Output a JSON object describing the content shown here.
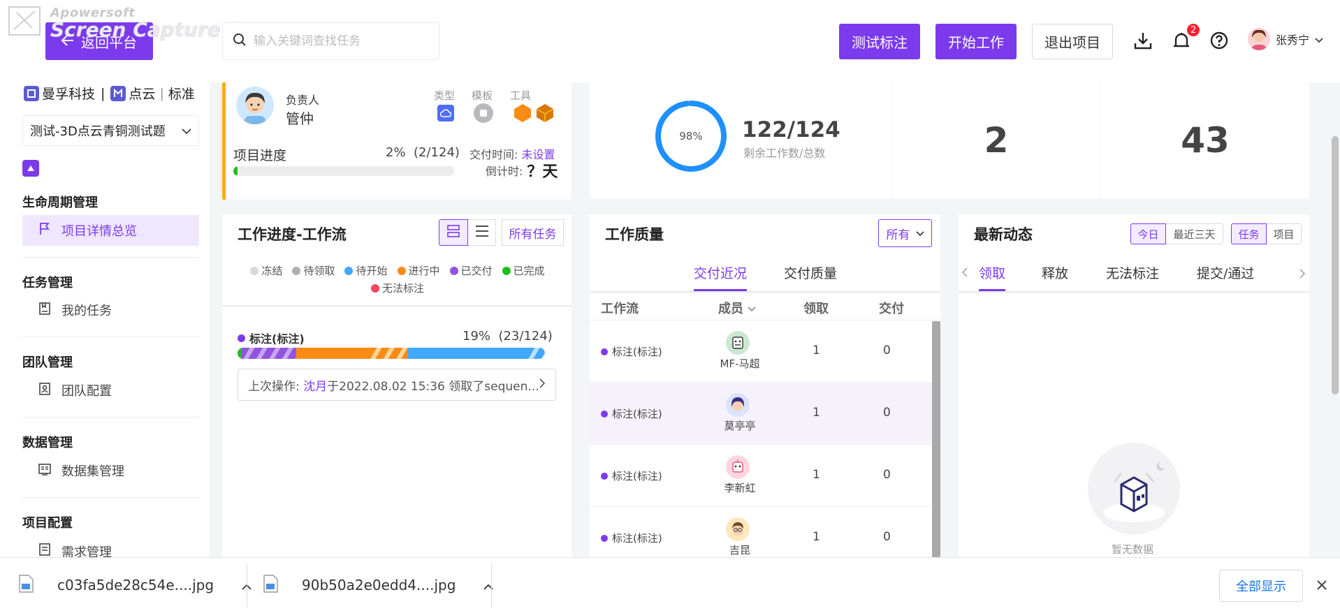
{
  "watermark": {
    "sub": "Apowersoft",
    "main": "Screen Capture Pro"
  },
  "header": {
    "back_label": "返回平台",
    "search_placeholder": "输入关键词查找任务",
    "btn_test": "测试标注",
    "btn_start": "开始工作",
    "btn_exit": "退出项目",
    "notification_count": "2",
    "user_name": "张秀宁"
  },
  "sidebar": {
    "org_name": "曼孚科技",
    "org_sep": "|",
    "org_type": "点云",
    "org_level": "标准",
    "project_name": "测试-3D点云青铜测试题",
    "sections": [
      {
        "title": "生命周期管理",
        "items": [
          {
            "label": "项目详情总览",
            "icon": "flag-icon"
          }
        ]
      },
      {
        "title": "任务管理",
        "items": [
          {
            "label": "我的任务",
            "icon": "task-icon"
          }
        ]
      },
      {
        "title": "团队管理",
        "items": [
          {
            "label": "团队配置",
            "icon": "team-icon"
          }
        ]
      },
      {
        "title": "数据管理",
        "items": [
          {
            "label": "数据集管理",
            "icon": "dataset-icon"
          }
        ]
      },
      {
        "title": "项目配置",
        "items": [
          {
            "label": "需求管理",
            "icon": "requirement-icon"
          }
        ]
      }
    ]
  },
  "project_card": {
    "owner_label": "负责人",
    "owner_name": "管仲",
    "type_label": "类型",
    "template_label": "模板",
    "tool_label": "工具",
    "progress_label": "项目进度",
    "progress_text": "2%  (2/124)",
    "progress_value": 0.02,
    "delivery_label": "交付时间:",
    "delivery_value": "未设置",
    "countdown_label": "倒计时:",
    "countdown_value": "？天"
  },
  "stats": {
    "ring_percent": "98%",
    "ring_value": 0.98,
    "remaining": "122/124",
    "remaining_label": "剩余工作数/总数",
    "stat2": "2",
    "stat3": "43"
  },
  "workflow": {
    "title": "工作进度-工作流",
    "filter_label": "所有任务",
    "legend": [
      {
        "label": "冻结",
        "color": "#d9d9d9"
      },
      {
        "label": "待领取",
        "color": "#b0b0b0"
      },
      {
        "label": "待开始",
        "color": "#40a9ff"
      },
      {
        "label": "进行中",
        "color": "#fa8c16"
      },
      {
        "label": "已交付",
        "color": "#9254de"
      },
      {
        "label": "已完成",
        "color": "#1fbf1f"
      },
      {
        "label": "无法标注",
        "color": "#f5455c"
      }
    ],
    "flow_name": "标注(标注)",
    "flow_progress": "19%  (23/124)",
    "last_op_prefix": "上次操作:",
    "last_op_user": "沈月",
    "last_op_text": "于2022.08.02 15:36 领取了sequen..."
  },
  "quality": {
    "title": "工作质量",
    "filter": "所有",
    "tabs": [
      "交付近况",
      "交付质量"
    ],
    "columns": [
      "工作流",
      "成员",
      "领取",
      "交付"
    ],
    "rows": [
      {
        "flow": "标注(标注)",
        "member": "MF-马超",
        "claim": "1",
        "deliver": "0"
      },
      {
        "flow": "标注(标注)",
        "member": "莫亭亭",
        "claim": "1",
        "deliver": "0"
      },
      {
        "flow": "标注(标注)",
        "member": "李新虹",
        "claim": "1",
        "deliver": "0"
      },
      {
        "flow": "标注(标注)",
        "member": "吉昆",
        "claim": "1",
        "deliver": "0"
      }
    ]
  },
  "news": {
    "title": "最新动态",
    "time_filters": [
      "今日",
      "最近三天"
    ],
    "type_filters": [
      "任务",
      "项目"
    ],
    "tabs": [
      "领取",
      "释放",
      "无法标注",
      "提交/通过"
    ],
    "empty_text": "暂无数据"
  },
  "downloads": {
    "files": [
      "c03fa5de28c54e....jpg",
      "90b50a2e0edd4....jpg"
    ],
    "show_all": "全部显示"
  }
}
